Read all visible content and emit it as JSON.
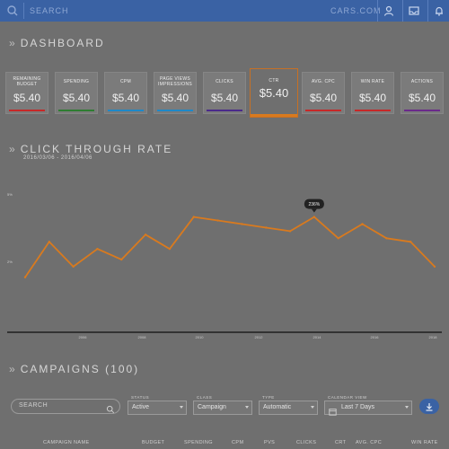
{
  "topbar": {
    "search_placeholder": "SEARCH",
    "brand": "CARS.COM",
    "icons": [
      "search-icon",
      "user-icon",
      "inbox-icon",
      "notification-bell-icon"
    ]
  },
  "dashboard": {
    "title": "DASHBOARD"
  },
  "stats": [
    {
      "label": "REMAINING BUDGET",
      "value": "$5.40",
      "color": "#c62828"
    },
    {
      "label": "SPENDING",
      "value": "$5.40",
      "color": "#2e7d32"
    },
    {
      "label": "CPM",
      "value": "$5.40",
      "color": "#1e88c8"
    },
    {
      "label": "PAGE VIEWS IMPRESSIONS",
      "value": "$5.40",
      "color": "#1e88c8"
    },
    {
      "label": "CLICKS",
      "value": "$5.40",
      "color": "#4a2a8a"
    },
    {
      "label": "CTR",
      "value": "$5.40",
      "color": "#d97a1e"
    },
    {
      "label": "AVG. CPC",
      "value": "$5.40",
      "color": "#c62828"
    },
    {
      "label": "WIN RATE",
      "value": "$5.40",
      "color": "#c62828"
    },
    {
      "label": "ACTIONS",
      "value": "$5.40",
      "color": "#6a2a8a"
    }
  ],
  "ctr_section": {
    "title": "CLICK THROUGH RATE",
    "date_range": "2016/03/06 - 2016/04/06"
  },
  "chart_data": {
    "type": "line",
    "series": [
      {
        "values": [
          15,
          25,
          18,
          23,
          20,
          27,
          23,
          32,
          31,
          30,
          29,
          28,
          32,
          26,
          30,
          26,
          25,
          18
        ]
      }
    ],
    "y_ticks": [
      "5%",
      "2%"
    ],
    "x_ticks": [
      "2006",
      "2008",
      "2010",
      "2012",
      "2014",
      "2016",
      "2018"
    ],
    "tooltip": {
      "point_index": 12,
      "label": "236%"
    },
    "line_color": "#d97a1e",
    "grid": false
  },
  "campaigns": {
    "title": "CAMPAIGNS (100)",
    "search_placeholder": "SEARCH",
    "filters": [
      {
        "label": "STATUS",
        "value": "Active"
      },
      {
        "label": "CLASS",
        "value": "Campaign"
      },
      {
        "label": "TYPE",
        "value": "Automatic"
      },
      {
        "label": "CALENDAR VIEW",
        "value": "Last 7 Days"
      }
    ],
    "columns": [
      "CAMPAIGN NAME",
      "BUDGET",
      "SPENDING",
      "CPM",
      "PVS",
      "CLICKS",
      "CRT",
      "AVG. CPC",
      "WIN RATE"
    ]
  }
}
